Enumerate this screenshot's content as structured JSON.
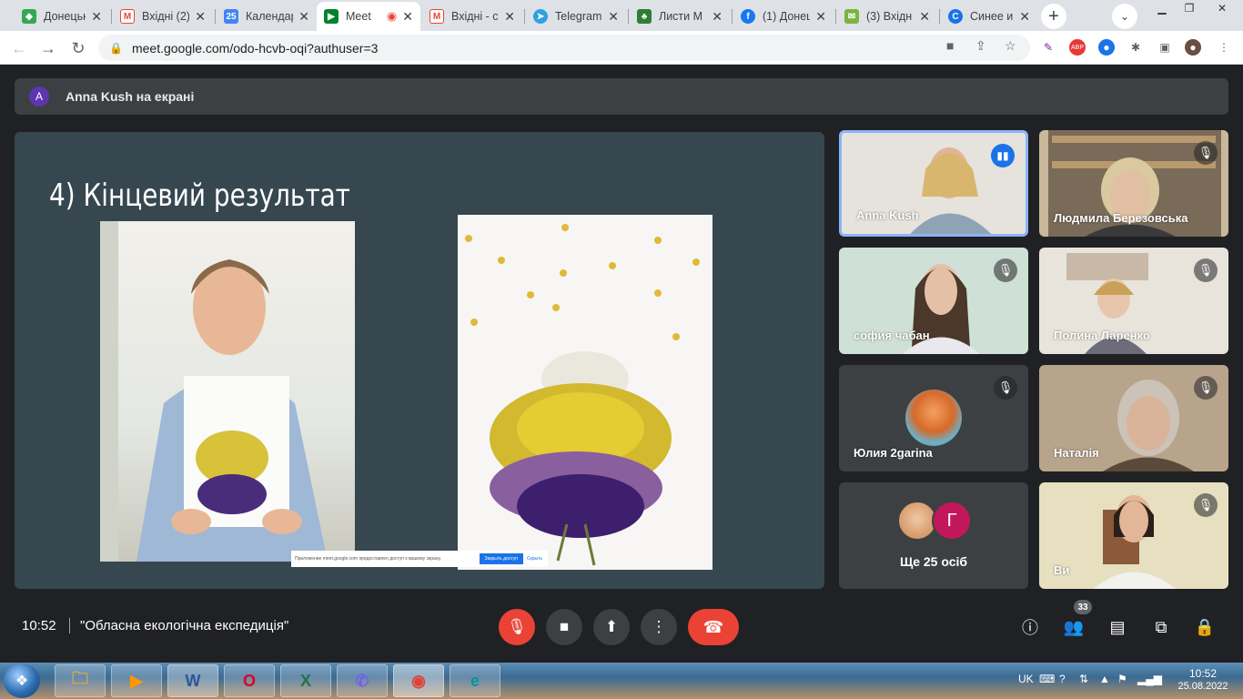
{
  "browser": {
    "tabs": [
      {
        "label": "Донецьк",
        "icon": "diamond-icon",
        "color": "#34a853"
      },
      {
        "label": "Вхідні (2)",
        "icon": "gmail-icon",
        "color": "#ea4335"
      },
      {
        "label": "Календар",
        "icon": "calendar-icon",
        "color": "#4285f4"
      },
      {
        "label": "Meet",
        "icon": "meet-icon",
        "color": "#00832d",
        "active": true
      },
      {
        "label": "Вхідні - c",
        "icon": "gmail-icon",
        "color": "#ea4335"
      },
      {
        "label": "Telegram",
        "icon": "telegram-icon",
        "color": "#2aa3e0"
      },
      {
        "label": "Листи М",
        "icon": "tree-icon",
        "color": "#2e7d32"
      },
      {
        "label": "(1) Донец",
        "icon": "facebook-icon",
        "color": "#1877f2"
      },
      {
        "label": "(3) Вхідн",
        "icon": "mail-icon",
        "color": "#7cb342"
      },
      {
        "label": "Синее и",
        "icon": "circle-c-icon",
        "color": "#1a73e8"
      }
    ],
    "url": "meet.google.com/odo-hcvb-oqi?authuser=3"
  },
  "meet": {
    "presenter_avatar": "A",
    "presenter_text": "Anna Kush на екрані",
    "slide_title": "4) Кінцевий результат",
    "notice_text": "Приложение meet.google.com предоставлен доступ к вашему экрану.",
    "notice_button": "Закрыть доступ",
    "notice_hide": "Скрыть",
    "participants": [
      {
        "name": "Anna Kush",
        "speaking": true
      },
      {
        "name": "Людмила Березовська",
        "muted": true
      },
      {
        "name": "софия чабан",
        "muted": true
      },
      {
        "name": "Полина Ларенко",
        "muted": true
      },
      {
        "name": "Юлия 2garina",
        "muted": true
      },
      {
        "name": "Наталія",
        "muted": true
      },
      {
        "name": "Ще 25 осіб",
        "avatar_letter": "Г"
      },
      {
        "name": "Ви",
        "muted": true
      }
    ],
    "clock": "10:52",
    "meeting_title": "\"Обласна екологічна експедиція\"",
    "people_count": "33"
  },
  "taskbar": {
    "lang": "UK",
    "time": "10:52",
    "date": "25.08.2022",
    "apps": [
      "explorer-icon",
      "media-player-icon",
      "word-icon",
      "opera-icon",
      "excel-icon",
      "viber-icon",
      "chrome-icon",
      "eset-icon"
    ]
  },
  "colors": {
    "accent": "#1a73e8",
    "danger": "#ea4335",
    "bg": "#202124",
    "tile": "#3c4043"
  }
}
